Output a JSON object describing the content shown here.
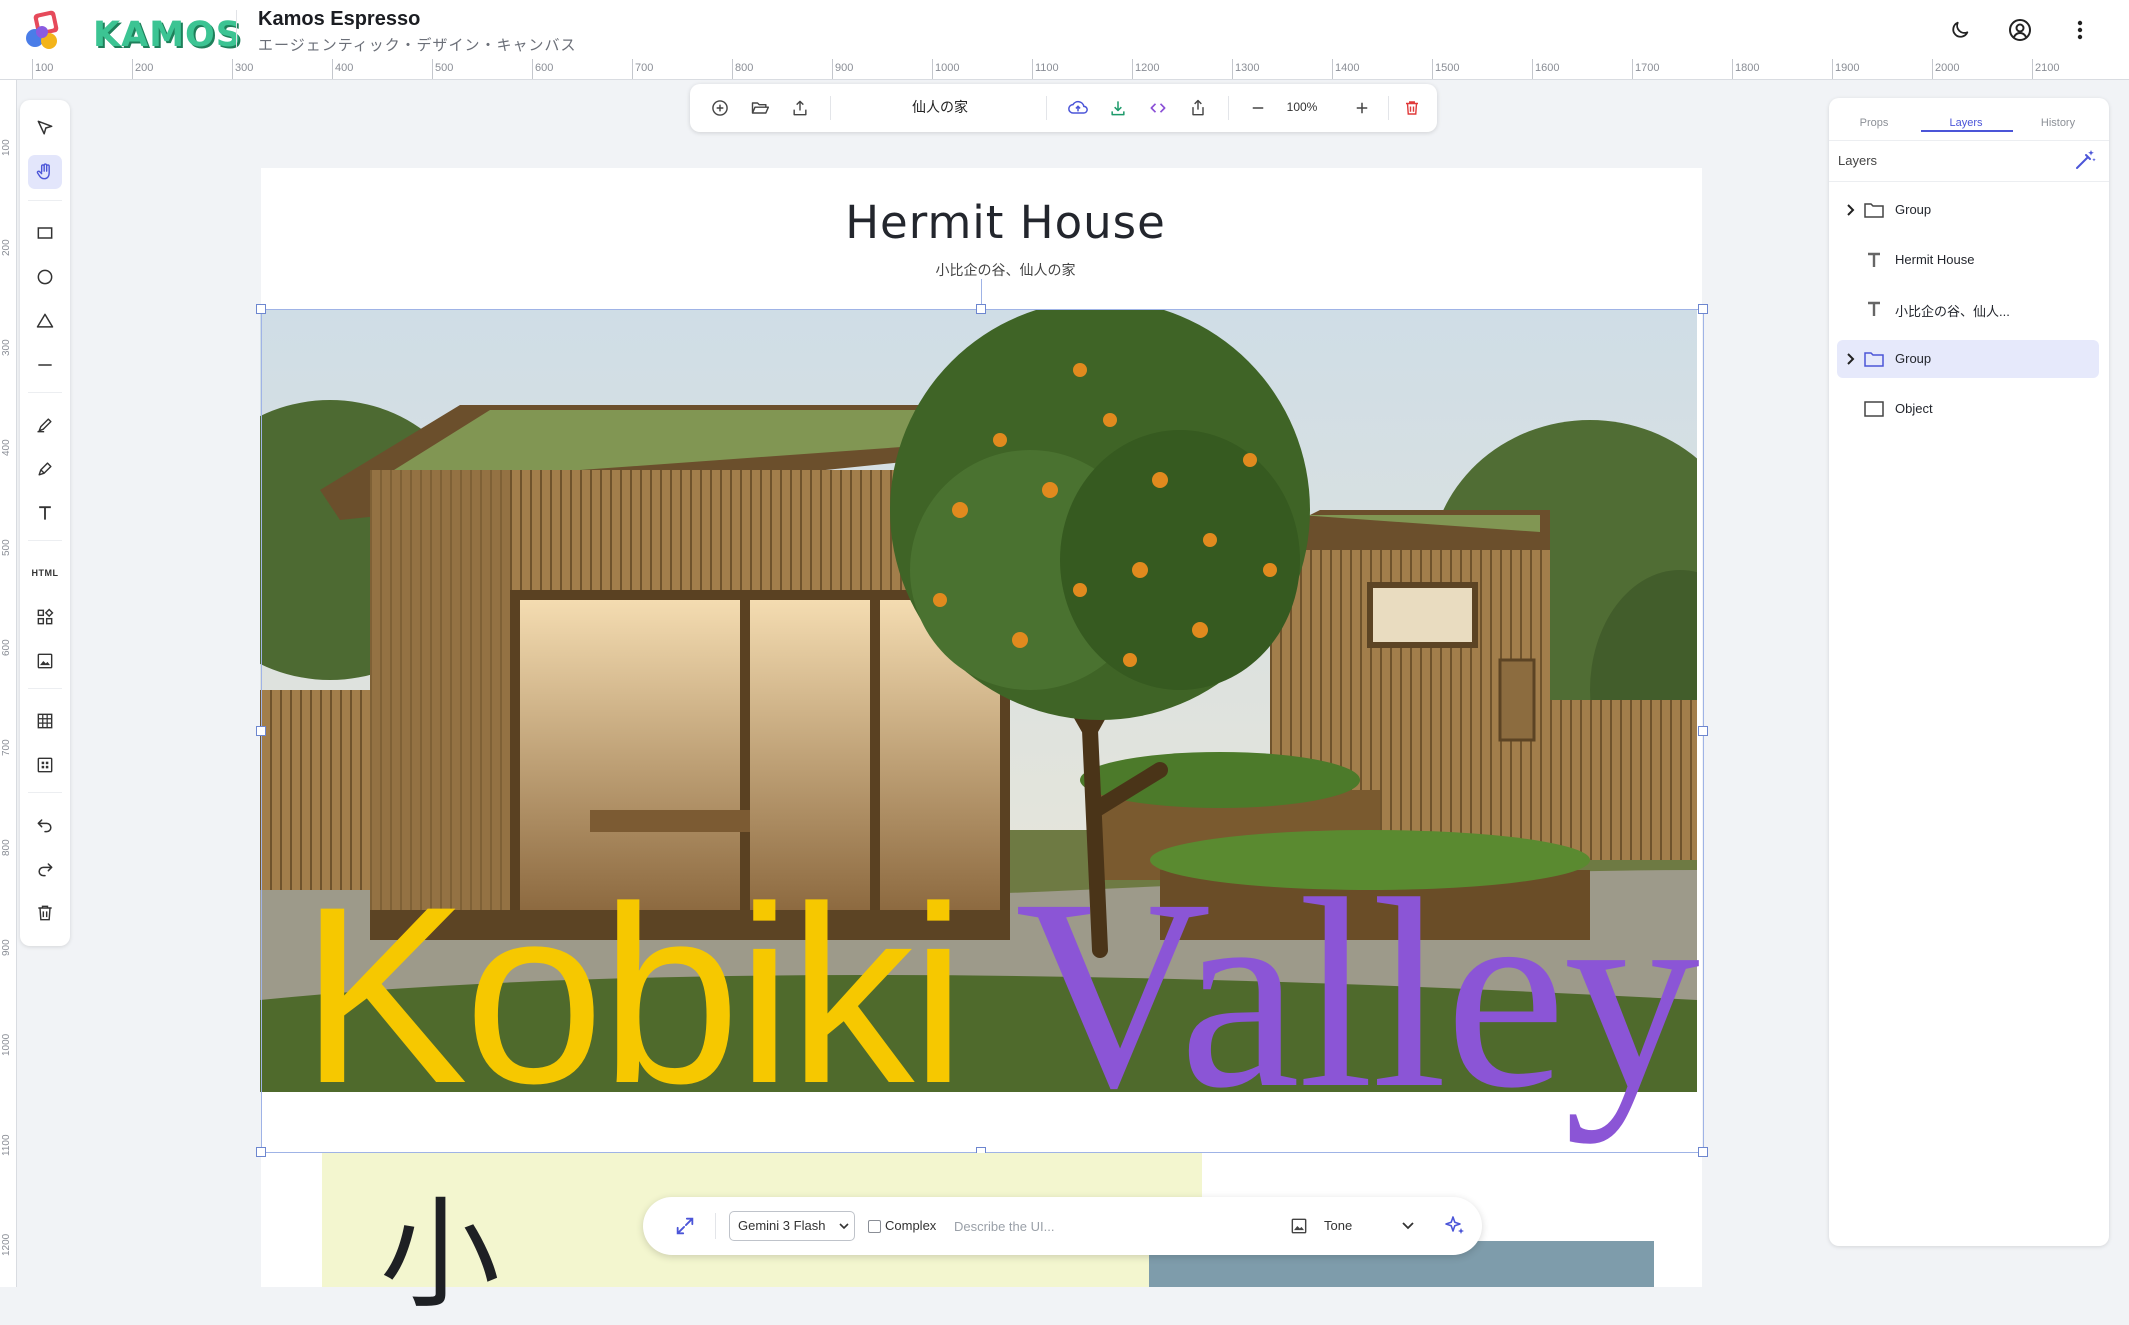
{
  "header": {
    "logo_text": "KAMOS",
    "app_title": "Kamos Espresso",
    "app_subtitle": "エージェンティック・デザイン・キャンバス"
  },
  "ruler": {
    "top_labels": [
      "100",
      "200",
      "300",
      "400",
      "500",
      "600",
      "700",
      "800",
      "900",
      "1000",
      "1100",
      "1200",
      "1300",
      "1400",
      "1500",
      "1600",
      "1700",
      "1800",
      "1900",
      "2000",
      "2100"
    ],
    "left_labels": [
      "100",
      "200",
      "300",
      "400",
      "500",
      "600",
      "700",
      "800",
      "900",
      "1000",
      "1100",
      "1200"
    ]
  },
  "left_toolbar": {
    "html_label": "HTML"
  },
  "top_toolbar": {
    "doc_name": "仙人の家",
    "zoom": "100%"
  },
  "canvas": {
    "title": "Hermit House",
    "subtitle": "小比企の谷、仙人の家",
    "hero_word_1": "Kobiki",
    "hero_word_2": "Valley",
    "big_kanji": "小"
  },
  "right_panel": {
    "tabs": [
      "Props",
      "Layers",
      "History"
    ],
    "active_tab": "Layers",
    "layers_heading": "Layers",
    "layers": [
      {
        "label": "Group",
        "type": "group"
      },
      {
        "label": "Hermit House",
        "type": "text"
      },
      {
        "label": "小比企の谷、仙人...",
        "type": "text"
      },
      {
        "label": "Group",
        "type": "group",
        "selected": true
      },
      {
        "label": "Object",
        "type": "object"
      }
    ]
  },
  "prompt_bar": {
    "model": "Gemini 3 Flash",
    "complex_label": "Complex",
    "complex_checked": false,
    "placeholder": "Describe the UI...",
    "tone": "Tone"
  },
  "colors": {
    "accent": "#4b55d8",
    "logo_green": "#3cc493",
    "hero_yellow": "#f6c800",
    "hero_purple": "#8b55d6",
    "delete_red": "#e03a3a",
    "download_green": "#1c9a6a"
  }
}
